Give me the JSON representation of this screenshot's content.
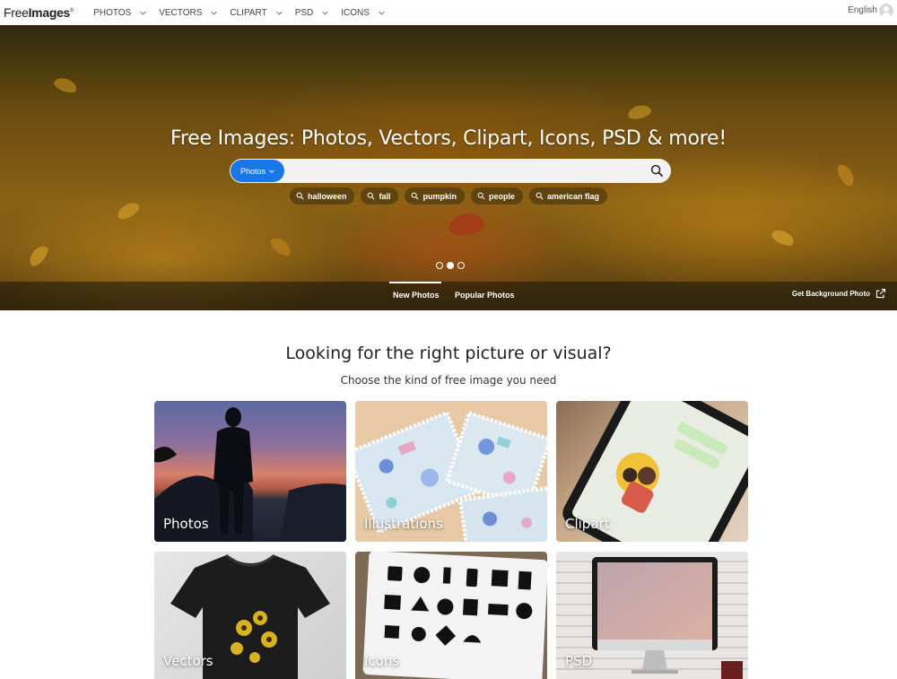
{
  "header": {
    "logo_text_light": "Free",
    "logo_text_bold": "Images",
    "nav": [
      "PHOTOS",
      "VECTORS",
      "CLIPART",
      "PSD",
      "ICONS"
    ],
    "language": "English"
  },
  "hero": {
    "title": "Free Images: Photos, Vectors, Clipart, Icons, PSD & more!",
    "search": {
      "type_label": "Photos",
      "placeholder": ""
    },
    "tags": [
      "halloween",
      "fall",
      "pumpkin",
      "people",
      "american flag"
    ],
    "carousel_active_index": 1,
    "tabs": [
      "New Photos",
      "Popular Photos"
    ],
    "active_tab": "New Photos",
    "background_link": "Get Background Photo"
  },
  "main": {
    "title": "Looking for the right picture or visual?",
    "subtitle": "Choose the kind of free image you need",
    "categories": [
      "Photos",
      "Illustrations",
      "Clipart",
      "Vectors",
      "Icons",
      "PSD"
    ]
  },
  "colors": {
    "accent": "#1976e6",
    "hero_overlay": "#19140a"
  }
}
